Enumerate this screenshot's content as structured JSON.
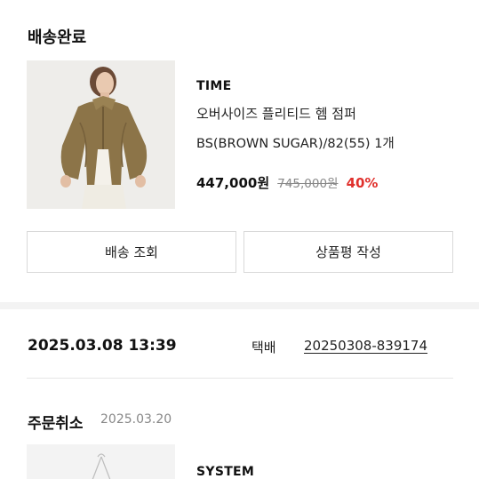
{
  "order1": {
    "status": "배송완료",
    "brand": "TIME",
    "product_name": "오버사이즈 플리티드 헴 점퍼",
    "option": "BS(BROWN SUGAR)/82(55) 1개",
    "price": "447,000원",
    "original_price": "745,000원",
    "discount": "40%",
    "discount_color": "#e0302c",
    "delivery_button": "배송 조회",
    "review_button": "상품평 작성"
  },
  "shipment": {
    "datetime": "2025.03.08 13:39",
    "courier": "택배",
    "tracking_number": "20250308-839174"
  },
  "order2": {
    "status": "주문취소",
    "date": "2025.03.20",
    "brand": "SYSTEM"
  }
}
